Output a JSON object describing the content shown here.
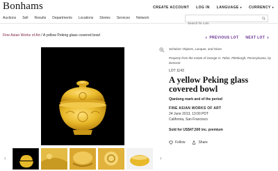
{
  "brand": {
    "logo": "Bonhams"
  },
  "nav": [
    "Auctions",
    "Sell",
    "Results",
    "Departments",
    "Locations",
    "Stories",
    "Services",
    "Network"
  ],
  "top_links": {
    "create_account": "CREATE ACCOUNT",
    "login": "LOG IN",
    "language": "LANGUAGE",
    "currency": "CURRENCY"
  },
  "search": {
    "placeholder": "Search for Lots"
  },
  "breadcrumb": {
    "link": "Fine Asian Works of Art",
    "separator": "/",
    "current": "A yellow Peking glass covered bowl"
  },
  "lot_nav": {
    "previous": "PREVIOUS LOT",
    "next": "NEXT LOT"
  },
  "lot": {
    "category": "Scholars' Objects, Lacquer, and Glass",
    "provenance": "Property from the estate of George H. Taber, Pittsburgh, Pennsylvania, by Descent",
    "lot_number": "LOT 1143",
    "title": "A yellow Peking glass covered bowl",
    "subtitle": "Qianlong mark and of the period",
    "department": "FINE ASIAN WORKS OF ART",
    "date": "24 June 2013, 13:00 PDT",
    "location": "California, San Francisco",
    "sold": "Sold for US$47,500 inc. premium"
  },
  "actions": {
    "follow": "Follow",
    "share": "Share"
  },
  "icons": [
    "search-icon",
    "zoom-icon",
    "follow-icon",
    "share-icon",
    "chevron-left-icon",
    "chevron-right-icon"
  ],
  "colors": {
    "accent": "#5a1e8a",
    "breadcrumb_link": "#7b1d3a",
    "glass_yellow": "#e8b92a"
  }
}
